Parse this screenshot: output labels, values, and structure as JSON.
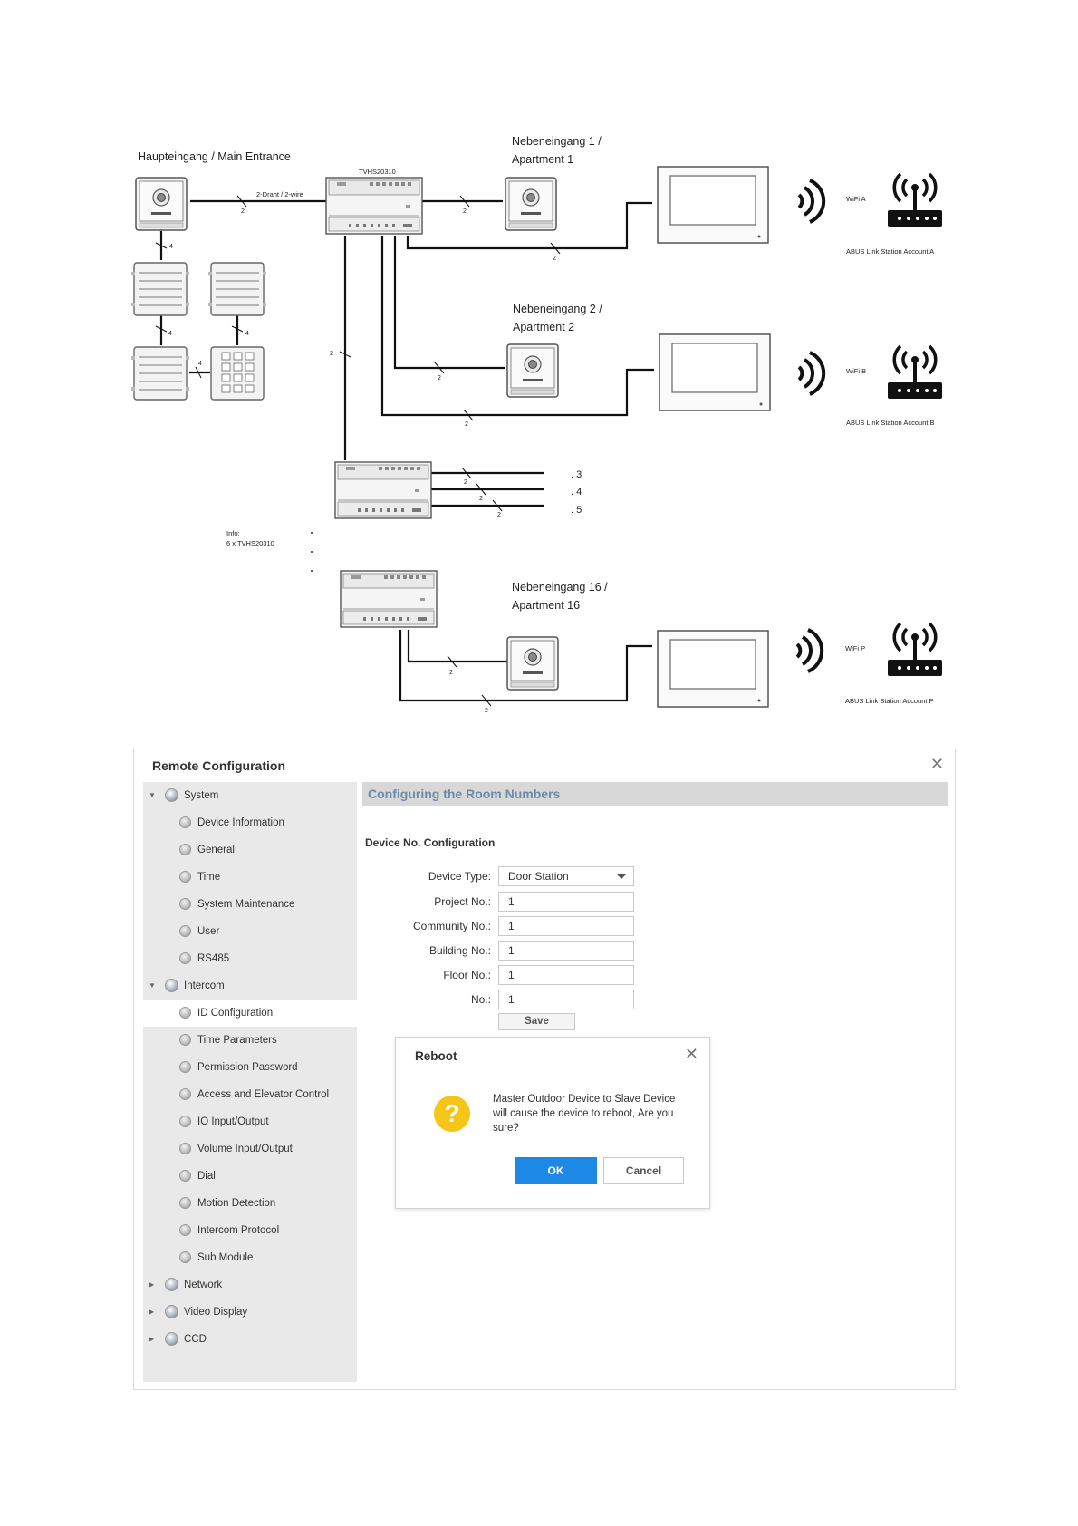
{
  "diagram": {
    "main_entrance": "Haupteingang / Main Entrance",
    "wire_label": "2-Draht / 2-wire",
    "device_model": "TVHS20310",
    "apt1_line1": "Nebeneingang 1 /",
    "apt1_line2": "Apartment 1",
    "apt2_line1": "Nebeneingang 2 /",
    "apt2_line2": "Apartment 2",
    "apt16_line1": "Nebeneingang 16 /",
    "apt16_line2": "Apartment 16",
    "wifi_a": "WiFi A",
    "wifi_b": "WiFi B",
    "wifi_p": "WiFi P",
    "account_a": "ABUS Link Station Account A",
    "account_b": "ABUS Link Station Account B",
    "account_p": "ABUS Link Station Account P",
    "info_line1": "Info:",
    "info_line2": "6 x TVHS20310",
    "idx_3": ". 3",
    "idx_4": ". 4",
    "idx_5": ". 5",
    "wire_count_2": "2",
    "wire_count_4": "4"
  },
  "remote_config": {
    "title": "Remote Configuration",
    "sidebar": [
      {
        "label": "System",
        "level": 0,
        "expanded": true
      },
      {
        "label": "Device Information",
        "level": 1
      },
      {
        "label": "General",
        "level": 1
      },
      {
        "label": "Time",
        "level": 1
      },
      {
        "label": "System Maintenance",
        "level": 1
      },
      {
        "label": "User",
        "level": 1
      },
      {
        "label": "RS485",
        "level": 1
      },
      {
        "label": "Intercom",
        "level": 0,
        "expanded": true
      },
      {
        "label": "ID Configuration",
        "level": 1,
        "active": true
      },
      {
        "label": "Time Parameters",
        "level": 1
      },
      {
        "label": "Permission Password",
        "level": 1
      },
      {
        "label": "Access and Elevator Control",
        "level": 1
      },
      {
        "label": "IO Input/Output",
        "level": 1
      },
      {
        "label": "Volume Input/Output",
        "level": 1
      },
      {
        "label": "Dial",
        "level": 1
      },
      {
        "label": "Motion Detection",
        "level": 1
      },
      {
        "label": "Intercom Protocol",
        "level": 1
      },
      {
        "label": "Sub Module",
        "level": 1
      },
      {
        "label": "Network",
        "level": 0,
        "expanded": false
      },
      {
        "label": "Video Display",
        "level": 0,
        "expanded": false
      },
      {
        "label": "CCD",
        "level": 0,
        "expanded": false
      }
    ],
    "banner": "Configuring the Room Numbers",
    "section_title": "Device No. Configuration",
    "fields": [
      {
        "label": "Device Type:",
        "value": "Door Station",
        "dropdown": true
      },
      {
        "label": "Project No.:",
        "value": "1"
      },
      {
        "label": "Community No.:",
        "value": "1"
      },
      {
        "label": "Building No.:",
        "value": "1"
      },
      {
        "label": "Floor No.:",
        "value": "1"
      },
      {
        "label": "No.:",
        "value": "1"
      }
    ],
    "save_label": "Save",
    "dialog": {
      "title": "Reboot",
      "message": "Master Outdoor Device to Slave Device will cause the device to reboot, Are you sure?",
      "ok_label": "OK",
      "cancel_label": "Cancel"
    },
    "colors": {
      "banner_text": "#6d8ba9",
      "ok_button": "#1e88e5",
      "question_icon": "#f5c518"
    }
  }
}
